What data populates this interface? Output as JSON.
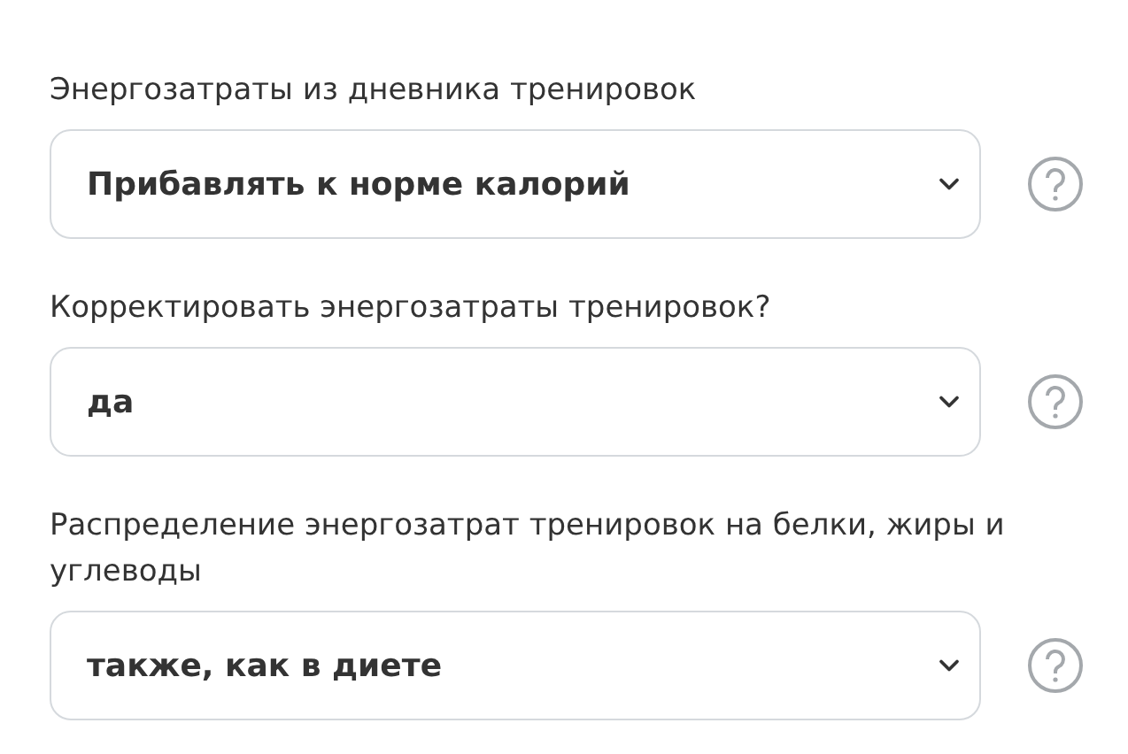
{
  "fields": [
    {
      "label": "Энергозатраты из дневника тренировок",
      "value": "Прибавлять к норме калорий"
    },
    {
      "label": "Корректировать энергозатраты тренировок?",
      "value": "да"
    },
    {
      "label": "Распределение энергозатрат тренировок на белки, жиры и углеводы",
      "value": "также, как в диете"
    }
  ]
}
